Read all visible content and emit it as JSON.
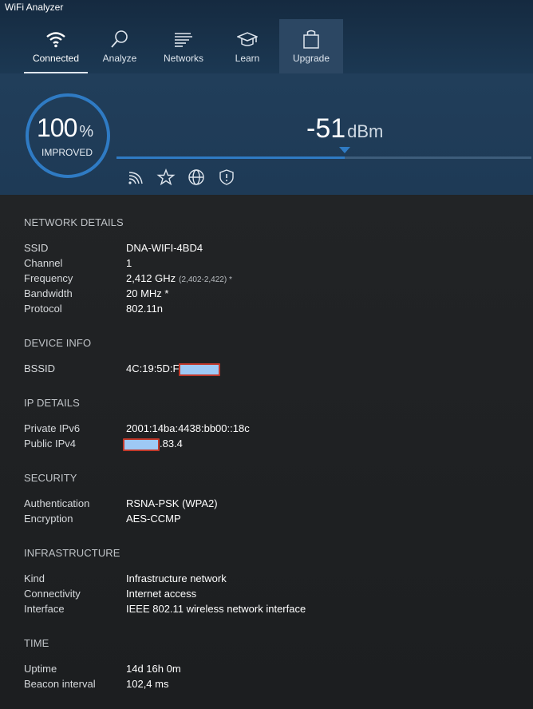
{
  "window": {
    "title": "WiFi Analyzer"
  },
  "nav": {
    "tabs": [
      {
        "label": "Connected",
        "icon": "wifi-icon",
        "active": true
      },
      {
        "label": "Analyze",
        "icon": "magnifier-icon"
      },
      {
        "label": "Networks",
        "icon": "networks-icon"
      },
      {
        "label": "Learn",
        "icon": "graduation-cap-icon"
      },
      {
        "label": "Upgrade",
        "icon": "shopping-bag-icon"
      }
    ]
  },
  "score": {
    "value": "100",
    "unit": "%",
    "label": "IMPROVED"
  },
  "signal": {
    "value": "-51",
    "unit": "dBm",
    "level_fraction": 0.55
  },
  "actions": [
    "signal-icon",
    "star-icon",
    "globe-icon",
    "shield-icon"
  ],
  "sections": {
    "network": {
      "title": "NETWORK DETAILS",
      "rows": [
        {
          "key": "SSID",
          "value": "DNA-WIFI-4BD4"
        },
        {
          "key": "Channel",
          "value": "1"
        },
        {
          "key": "Frequency",
          "value": "2,412 GHz",
          "sub": "(2,402-2,422) *"
        },
        {
          "key": "Bandwidth",
          "value": "20 MHz *"
        },
        {
          "key": "Protocol",
          "value": "802.11n"
        }
      ]
    },
    "device": {
      "title": "DEVICE INFO",
      "rows": [
        {
          "key": "BSSID",
          "value": "4C:19:5D:F"
        }
      ]
    },
    "ip": {
      "title": "IP DETAILS",
      "rows": [
        {
          "key": "Private IPv6",
          "value": "2001:14ba:4438:bb00::18c"
        },
        {
          "key": "Public IPv4",
          "value": ".83.4"
        }
      ]
    },
    "security": {
      "title": "SECURITY",
      "rows": [
        {
          "key": "Authentication",
          "value": "RSNA-PSK (WPA2)"
        },
        {
          "key": "Encryption",
          "value": "AES-CCMP"
        }
      ]
    },
    "infrastructure": {
      "title": "INFRASTRUCTURE",
      "rows": [
        {
          "key": "Kind",
          "value": "Infrastructure network"
        },
        {
          "key": "Connectivity",
          "value": "Internet access"
        },
        {
          "key": "Interface",
          "value": "IEEE 802.11 wireless network interface"
        }
      ]
    },
    "time": {
      "title": "TIME",
      "rows": [
        {
          "key": "Uptime",
          "value": "14d 16h 0m"
        },
        {
          "key": "Beacon interval",
          "value": "102,4 ms"
        }
      ]
    }
  }
}
